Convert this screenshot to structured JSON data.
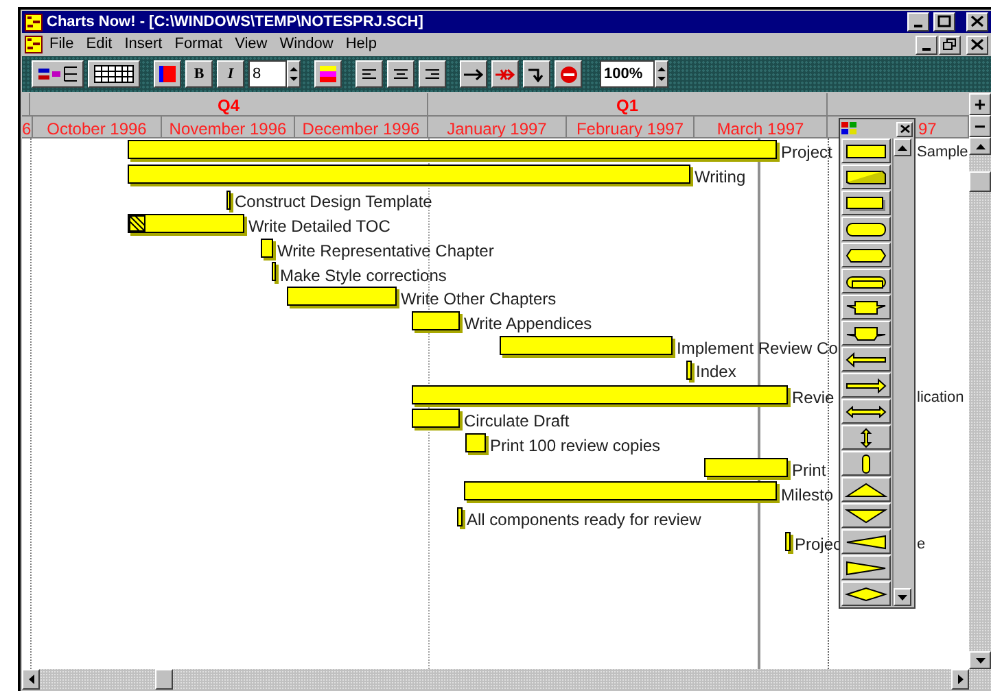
{
  "window": {
    "title": "Charts Now! - [C:\\WINDOWS\\TEMP\\NOTESPRJ.SCH]"
  },
  "menu": [
    "File",
    "Edit",
    "Insert",
    "Format",
    "View",
    "Window",
    "Help"
  ],
  "toolbar": {
    "bold": "B",
    "italic": "I",
    "font_size": "8",
    "zoom": "100%"
  },
  "timeline": {
    "quarters": [
      "Q4",
      "Q1"
    ],
    "months": [
      "6",
      "October 1996",
      "November 1996",
      "December 1996",
      "January 1997",
      "February 1997",
      "March 1997",
      "97"
    ],
    "zoom_in": "+",
    "zoom_out": "−"
  },
  "tasks": [
    {
      "label": "Project",
      "tail": "Sample",
      "hatched": false
    },
    {
      "label": "Writing",
      "hatched": false
    },
    {
      "label": "Construct Design Template",
      "hatched": false
    },
    {
      "label": "Write Detailed TOC",
      "hatched": true
    },
    {
      "label": "Write Representative Chapter",
      "hatched": false
    },
    {
      "label": "Make Style corrections",
      "hatched": false
    },
    {
      "label": "Write Other Chapters",
      "hatched": false
    },
    {
      "label": "Write Appendices",
      "hatched": false
    },
    {
      "label": "Implement Review Co",
      "hatched": false
    },
    {
      "label": "Index",
      "hatched": false
    },
    {
      "label": "Revie",
      "tail": "lication",
      "hatched": false
    },
    {
      "label": "Circulate Draft",
      "hatched": false
    },
    {
      "label": "Print 100 review copies",
      "hatched": false
    },
    {
      "label": "Print",
      "hatched": false
    },
    {
      "label": "Milesto",
      "hatched": false
    },
    {
      "label": "All components ready for review",
      "hatched": false
    },
    {
      "label": "Projec",
      "tail": "e",
      "hatched": false
    }
  ]
}
